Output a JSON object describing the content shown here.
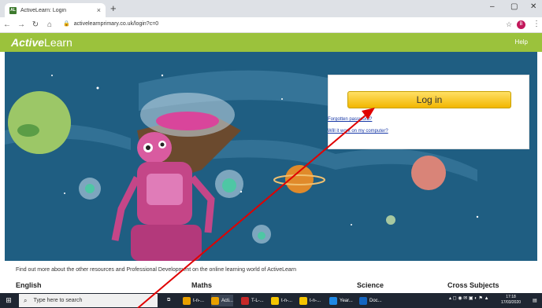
{
  "browser": {
    "tab_title": "ActiveLearn: Login",
    "tab_favicon": "AL",
    "close_tab": "×",
    "new_tab": "+",
    "window_min": "–",
    "window_max": "▢",
    "window_close": "✕",
    "url": "activelearnprimary.co.uk/login?c=0",
    "profile_initial": "B"
  },
  "site": {
    "logo_italic": "Active",
    "logo_rest": "Learn",
    "help_label": "Help"
  },
  "login": {
    "login_button": "Log in",
    "forgotten_password": "Forgotten password?",
    "will_it_work": "Will it work on my computer?"
  },
  "footer": {
    "intro_text": "Find out more about the other resources and Professional Development on the online learning world of ActiveLearn",
    "subjects": [
      "English",
      "Maths",
      "Science",
      "Cross Subjects"
    ]
  },
  "taskbar": {
    "search_placeholder": "Type here to search",
    "apps": [
      {
        "label": "t-n-...",
        "color": "#e8a000"
      },
      {
        "label": "Acti...",
        "color": "#e8a000"
      },
      {
        "label": "T-L-...",
        "color": "#c62828"
      },
      {
        "label": "t-n-...",
        "color": "#f5c400"
      },
      {
        "label": "t-n-...",
        "color": "#f5c400"
      },
      {
        "label": "Year...",
        "color": "#1e88e5"
      },
      {
        "label": "Doc...",
        "color": "#1565c0"
      }
    ],
    "time": "17:18",
    "date": "17/03/2020"
  },
  "colors": {
    "brand_green": "#9bc23c",
    "hero_blue": "#1f5e82",
    "login_yellow": "#f2b600",
    "annotation_arrow": "#e00000"
  }
}
